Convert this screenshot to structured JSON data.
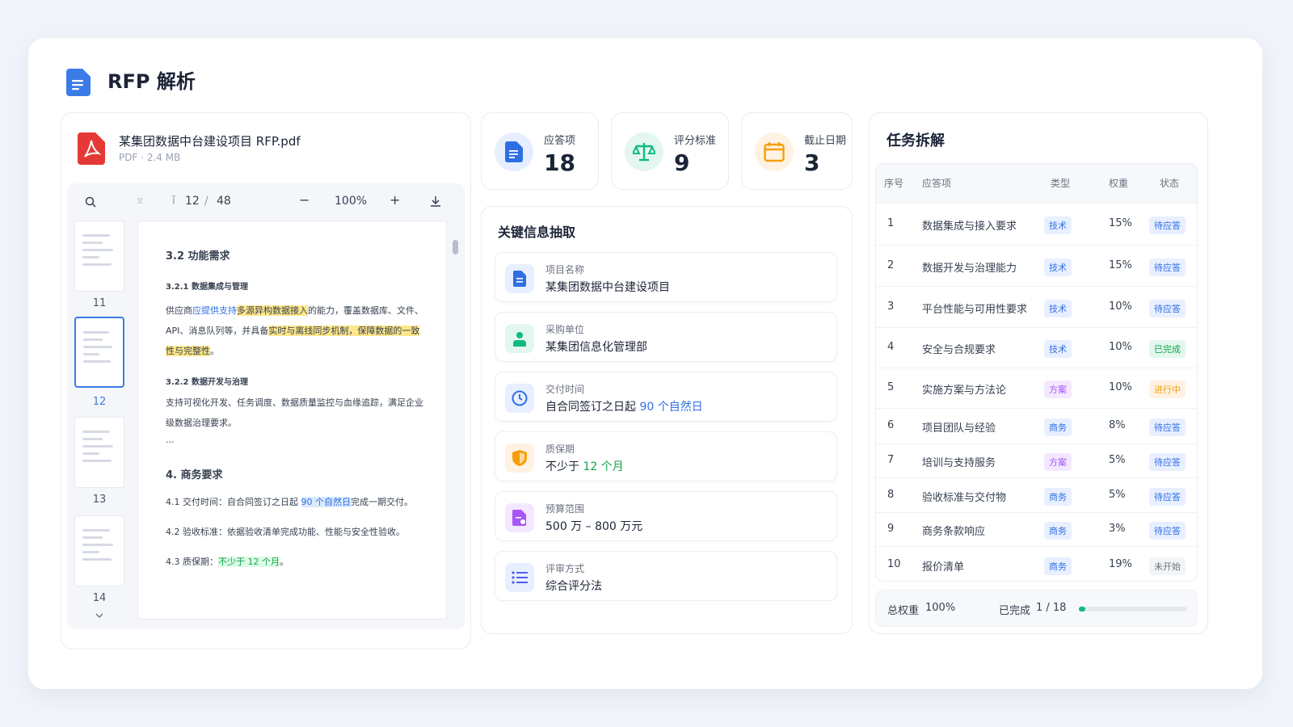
{
  "header": {
    "title": "RFP 解析"
  },
  "file": {
    "name": "某集团数据中台建设项目 RFP.pdf",
    "meta": "PDF · 2.4 MB"
  },
  "viewer": {
    "page_current": "12",
    "page_sep": "/",
    "page_total": "48",
    "zoom": "100%",
    "zoom_out": "−",
    "zoom_in": "+",
    "thumbs": [
      "11",
      "12",
      "13",
      "14"
    ],
    "doc": {
      "h1": "3.2 功能需求",
      "h2a": "3.2.1  数据集成与管理",
      "p1a_pre": "供应商",
      "p1a_blue": "应提供支持",
      "p1a_hl": "多源异构数据接入",
      "p1a_post": "的能力，覆盖数据库、文件、",
      "p1b_pre": "API、消息队列等，并具备",
      "p1b_hl": "实时与离线同步机制，保障数据的一致",
      "p1c_hl": "性与完整性",
      "p1c_post": "。",
      "h2b": "3.2.2  数据开发与治理",
      "p2a": "支持可视化开发、任务调度、数据质量监控与血缘追踪，满足企业",
      "p2b": "级数据治理要求。",
      "ellipsis": "...",
      "h1b": "4. 商务要求",
      "l41_pre": "4.1  交付时间：自合同签订之日起 ",
      "l41_hl": "90 个自然日",
      "l41_post": "完成一期交付。",
      "l42": "4.2  验收标准：依据验收清单完成功能、性能与安全性验收。",
      "l43_pre": "4.3  质保期：",
      "l43_hl": "不少于 12 个月",
      "l43_post": "。"
    }
  },
  "stats": [
    {
      "label": "应答项",
      "value": "18",
      "color": "#2f6fe4"
    },
    {
      "label": "评分标准",
      "value": "9",
      "color": "#10b981"
    },
    {
      "label": "截止日期",
      "value": "3",
      "color": "#f59e0b"
    }
  ],
  "key_info": {
    "title": "关键信息抽取",
    "items": [
      {
        "label": "项目名称",
        "value": "某集团数据中台建设项目"
      },
      {
        "label": "采购单位",
        "value": "某集团信息化管理部"
      },
      {
        "label": "交付时间",
        "value_pre": "自合同签订之日起 ",
        "value_hl": "90 个自然日"
      },
      {
        "label": "质保期",
        "value_pre": "不少于 ",
        "value_hl": "12 个月"
      },
      {
        "label": "预算范围",
        "value": "500 万 – 800 万元"
      },
      {
        "label": "评审方式",
        "value": "综合评分法"
      }
    ]
  },
  "tasks": {
    "title": "任务拆解",
    "columns": [
      "序号",
      "应答项",
      "类型",
      "权重",
      "状态"
    ],
    "rows": [
      {
        "no": "1",
        "item": "数据集成与接入要求",
        "type": "技术",
        "weight": "15%",
        "status": "待应答"
      },
      {
        "no": "2",
        "item": "数据开发与治理能力",
        "type": "技术",
        "weight": "15%",
        "status": "待应答"
      },
      {
        "no": "3",
        "item": "平台性能与可用性要求",
        "type": "技术",
        "weight": "10%",
        "status": "待应答"
      },
      {
        "no": "4",
        "item": "安全与合规要求",
        "type": "技术",
        "weight": "10%",
        "status": "已完成"
      },
      {
        "no": "5",
        "item": "实施方案与方法论",
        "type": "方案",
        "weight": "10%",
        "status": "进行中"
      },
      {
        "no": "6",
        "item": "项目团队与经验",
        "type": "商务",
        "weight": "8%",
        "status": "待应答"
      },
      {
        "no": "7",
        "item": "培训与支持服务",
        "type": "方案",
        "weight": "5%",
        "status": "待应答"
      },
      {
        "no": "8",
        "item": "验收标准与交付物",
        "type": "商务",
        "weight": "5%",
        "status": "待应答"
      },
      {
        "no": "9",
        "item": "商务条款响应",
        "type": "商务",
        "weight": "3%",
        "status": "待应答"
      },
      {
        "no": "10",
        "item": "报价清单",
        "type": "商务",
        "weight": "19%",
        "status": "未开始"
      }
    ],
    "footer": {
      "total_label": "总权重",
      "total_value": "100%",
      "done_label": "已完成",
      "done_value": "1 / 18",
      "progress": 0.056
    }
  },
  "colors": {
    "accent": "#2f6fe4",
    "success": "#16a34a",
    "warning": "#f59e0b",
    "purple": "#a855f7"
  }
}
